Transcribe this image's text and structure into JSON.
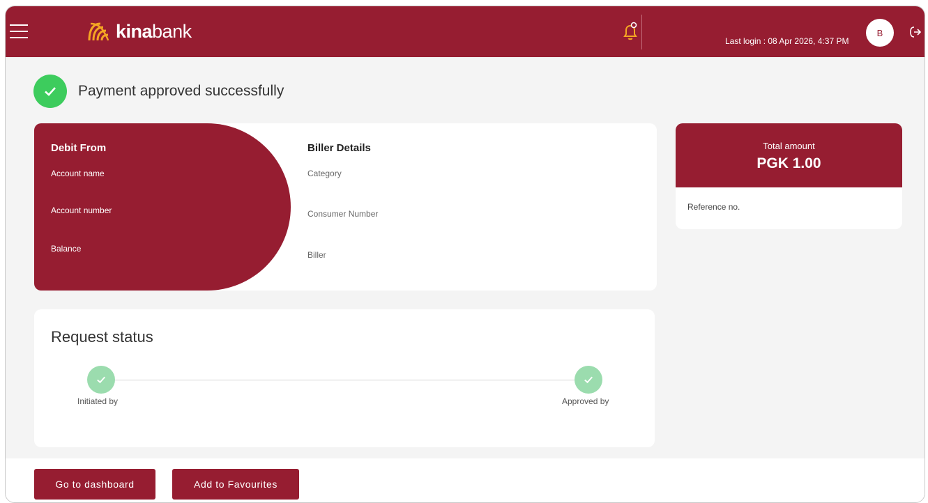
{
  "header": {
    "brand_bold": "kina",
    "brand_light": "bank",
    "last_login": "Last login : 08 Apr 2026, 4:37 PM",
    "avatar_initial": "B",
    "menu_icon": "hamburger-icon",
    "notification_icon": "bell-icon",
    "logout_icon": "logout-icon"
  },
  "success": {
    "message": "Payment approved successfully"
  },
  "debit": {
    "title": "Debit From",
    "fields": [
      "Account name",
      "Account number",
      "Balance"
    ]
  },
  "biller": {
    "title": "Biller Details",
    "fields": [
      "Category",
      "Consumer Number",
      "Biller"
    ]
  },
  "total": {
    "label": "Total amount",
    "value": "PGK 1.00",
    "reference_label": "Reference no."
  },
  "status": {
    "title": "Request status",
    "steps": [
      "Initiated by",
      "Approved by"
    ]
  },
  "actions": {
    "dashboard": "Go to dashboard",
    "favourites": "Add to Favourites"
  },
  "colors": {
    "brand": "#961d31",
    "logo_accent": "#f5a623",
    "success": "#3dcc5d",
    "step_done": "#9bdcae"
  }
}
